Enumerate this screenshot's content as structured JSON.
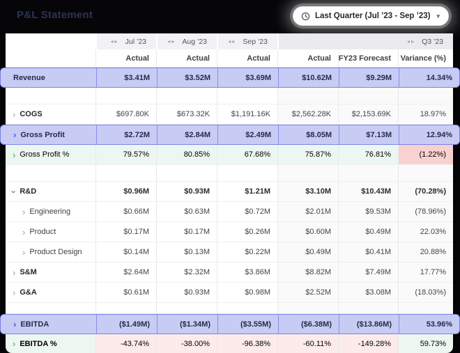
{
  "header": {
    "title": "P&L Statement",
    "period_selector": {
      "label": "Last Quarter (Jul ’23 - Sep ’23)",
      "caret": "▾"
    }
  },
  "icons": {
    "chevron": "›",
    "prev_arrow": "◂",
    "next_arrow": "▸"
  },
  "colors": {
    "accent_purple": "#7a81e9",
    "selected_bg": "#c8ccf4",
    "positive_green": "#1d8045",
    "negative_red": "#d8322c",
    "header_overlay": "#060609"
  },
  "table": {
    "column_groups": [
      {
        "label": "Jul ’23"
      },
      {
        "label": "Aug ’23"
      },
      {
        "label": "Sep ’23"
      },
      {
        "label": "Q3 ’23"
      }
    ],
    "subheaders": [
      "Actual",
      "Actual",
      "Actual",
      "Actual",
      "FY23 Forecast",
      "Variance (%)"
    ],
    "rows": [
      {
        "type": "data",
        "style": "sel",
        "label": "Revenue",
        "chevron": null,
        "values": [
          "$3.41M",
          "$3.52M",
          "$3.69M",
          "$10.62M",
          "$9.29M",
          "14.34%"
        ]
      },
      {
        "type": "spacer",
        "height": 23
      },
      {
        "type": "data",
        "style": "parent",
        "label": "COGS",
        "chevron": "right",
        "values": [
          "$697.80K",
          "$673.32K",
          "$1,191.16K",
          "$2,562.28K",
          "$2,153.69K",
          "18.97%"
        ]
      },
      {
        "type": "data",
        "style": "sel",
        "label": "Gross Profit",
        "chevron": "right",
        "values": [
          "$2.72M",
          "$2.84M",
          "$2.49M",
          "$8.05M",
          "$7.13M",
          "12.94%"
        ]
      },
      {
        "type": "data",
        "style": "percent",
        "label": "Gross Profit %",
        "chevron": "right",
        "label_tone": "green",
        "tones": [
          "green",
          "green",
          "green",
          "green",
          "green",
          "redstrong"
        ],
        "values": [
          "79.57%",
          "80.85%",
          "67.68%",
          "75.87%",
          "76.81%",
          "(1.22%)"
        ]
      },
      {
        "type": "spacer",
        "height": 23
      },
      {
        "type": "data",
        "style": "parent bv",
        "label": "R&D",
        "chevron": "down",
        "values": [
          "$0.96M",
          "$0.93M",
          "$1.21M",
          "$3.10M",
          "$10.43M",
          "(70.28%)"
        ]
      },
      {
        "type": "data",
        "style": "child",
        "label": "Engineering",
        "chevron": "right",
        "values": [
          "$0.66M",
          "$0.63M",
          "$0.72M",
          "$2.01M",
          "$9.53M",
          "(78.96%)"
        ]
      },
      {
        "type": "data",
        "style": "child",
        "label": "Product",
        "chevron": "right",
        "values": [
          "$0.17M",
          "$0.17M",
          "$0.26M",
          "$0.60M",
          "$0.49M",
          "22.03%"
        ]
      },
      {
        "type": "data",
        "style": "child",
        "label": "Product Design",
        "chevron": "right",
        "values": [
          "$0.14M",
          "$0.13M",
          "$0.22M",
          "$0.49M",
          "$0.41M",
          "20.88%"
        ]
      },
      {
        "type": "data",
        "style": "parent",
        "label": "S&M",
        "chevron": "right",
        "values": [
          "$2.64M",
          "$2.32M",
          "$3.86M",
          "$8.82M",
          "$7.49M",
          "17.77%"
        ]
      },
      {
        "type": "data",
        "style": "parent",
        "label": "G&A",
        "chevron": "right",
        "values": [
          "$0.61M",
          "$0.93M",
          "$0.98M",
          "$2.52M",
          "$3.08M",
          "(18.03%)"
        ]
      },
      {
        "type": "spacer",
        "height": 15
      },
      {
        "type": "data",
        "style": "sel",
        "label": "EBITDA",
        "chevron": "right",
        "values": [
          "($1.49M)",
          "($1.34M)",
          "($3.55M)",
          "($6.38M)",
          "($13.86M)",
          "53.96%"
        ]
      },
      {
        "type": "data",
        "style": "percent lastrow",
        "label": "EBITDA %",
        "chevron": "right",
        "label_tone": "green",
        "tones": [
          "red",
          "red",
          "red",
          "red",
          "red",
          "green"
        ],
        "values": [
          "-43.74%",
          "-38.00%",
          "-96.38%",
          "-60.11%",
          "-149.28%",
          "59.73%"
        ]
      }
    ]
  }
}
